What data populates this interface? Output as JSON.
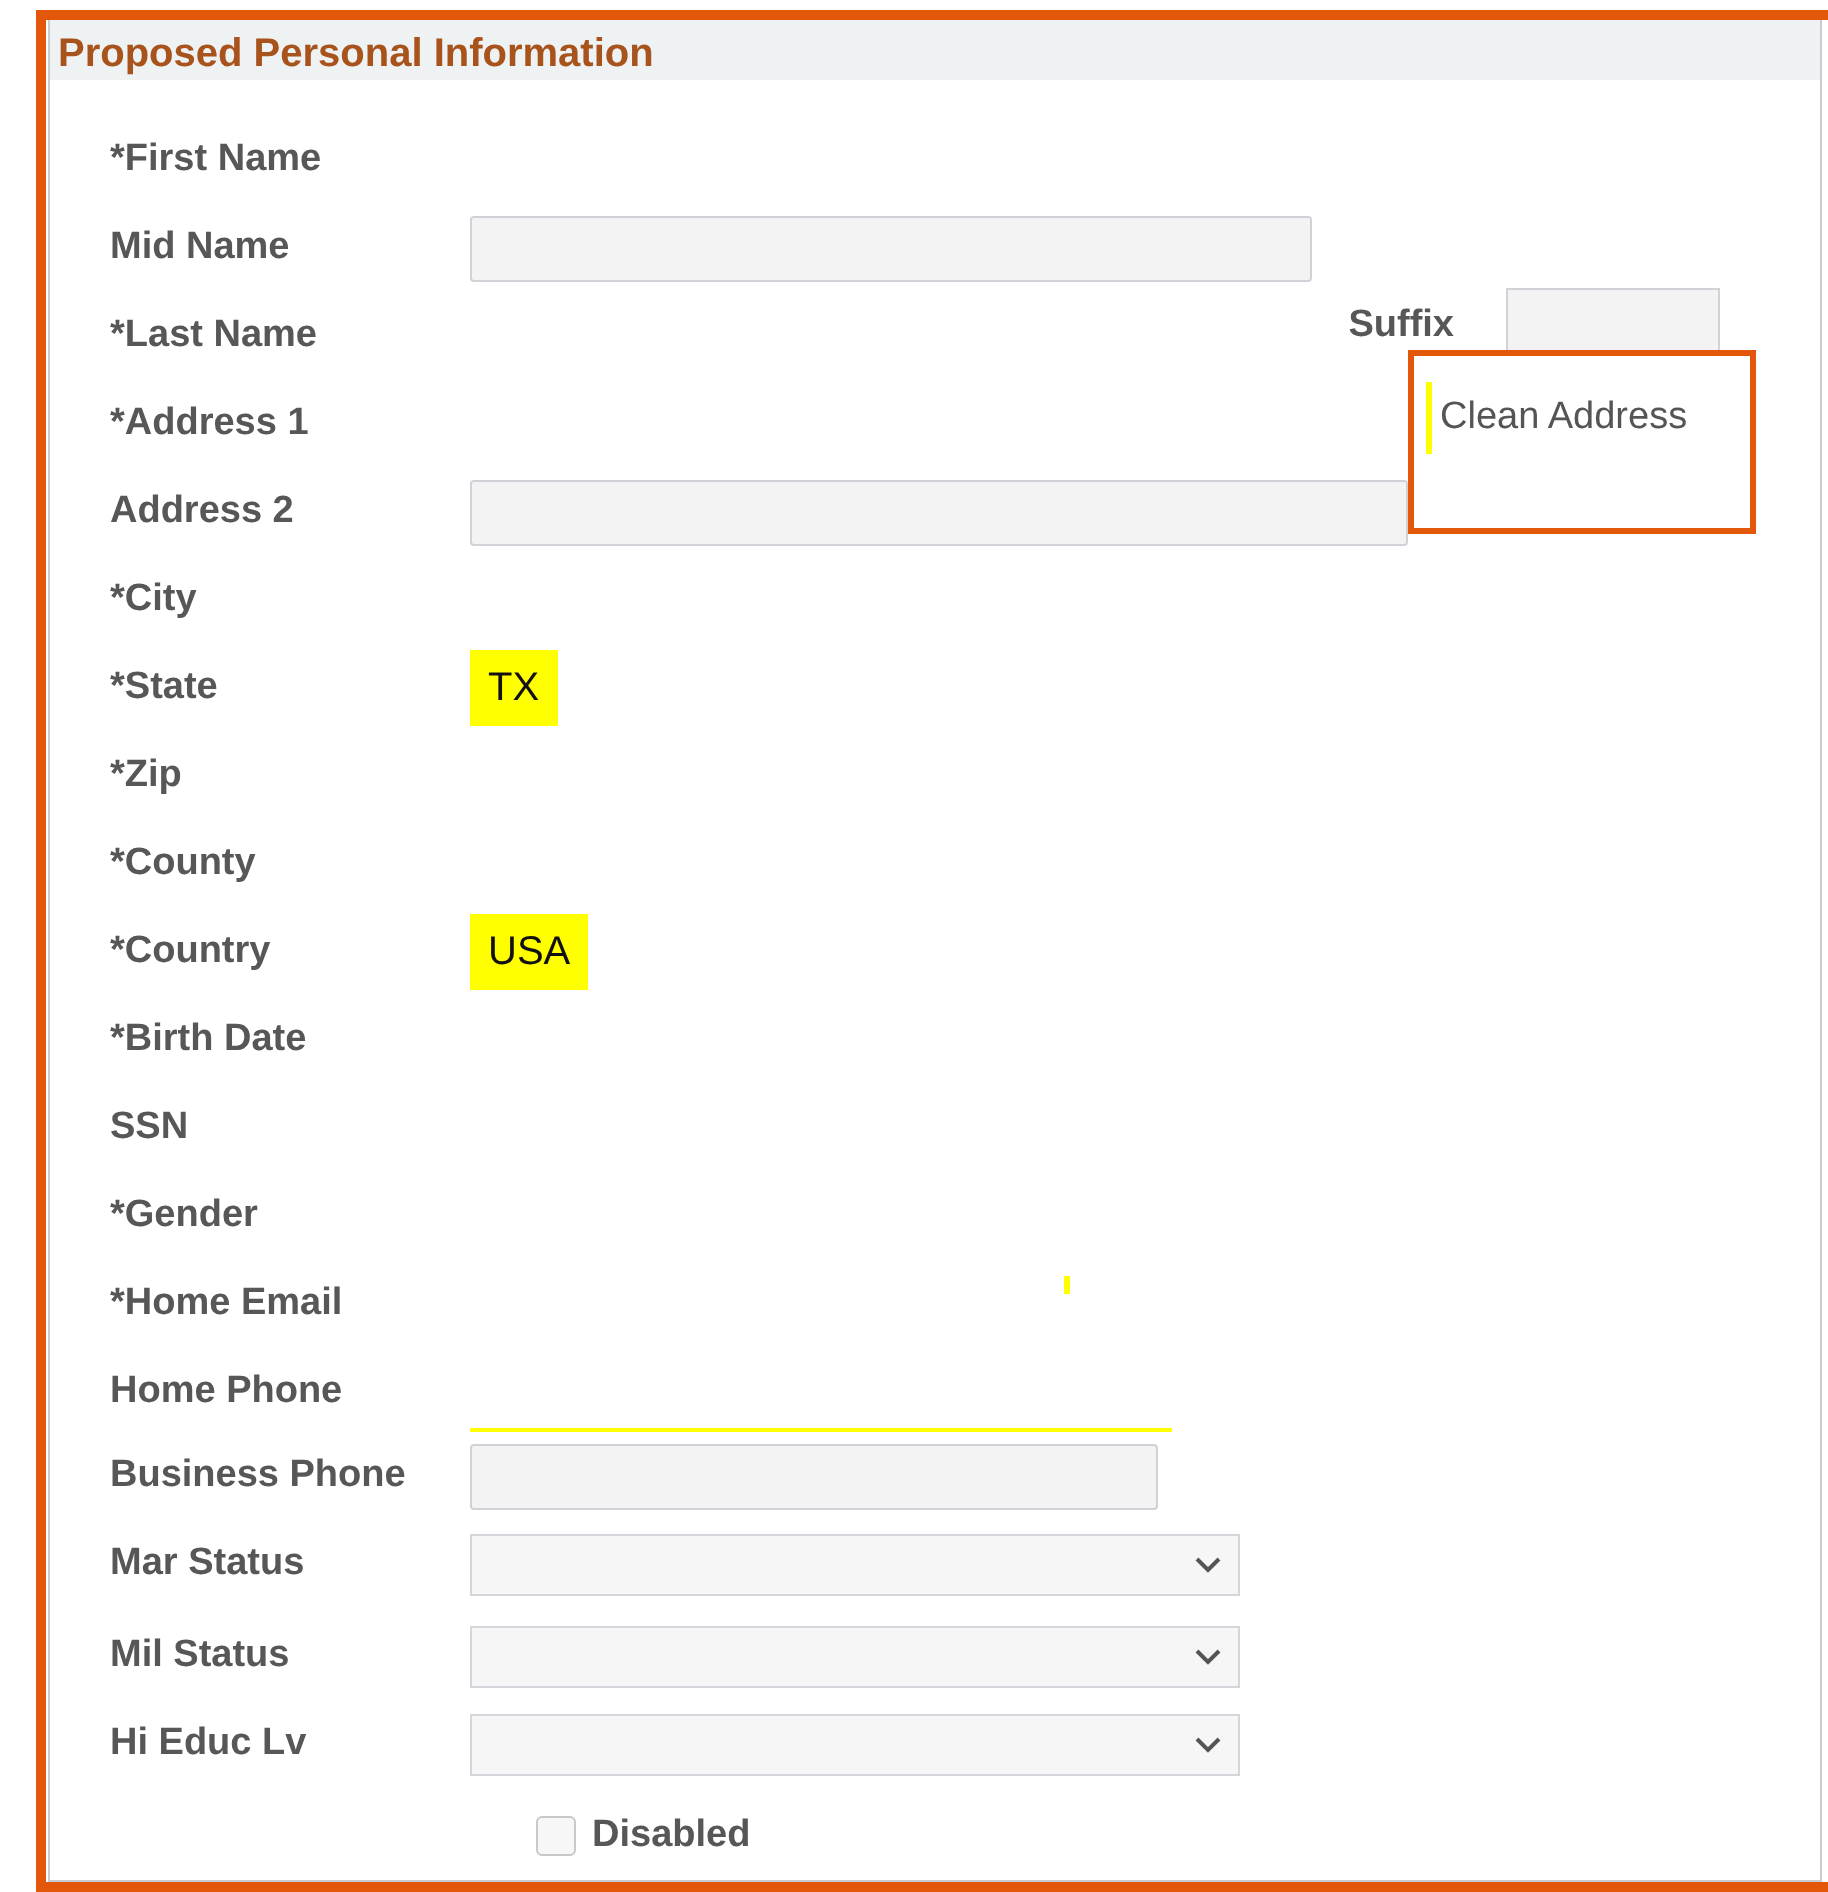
{
  "section": {
    "title": "Proposed Personal Information"
  },
  "fields": [
    {
      "label": "*First Name",
      "kind": "none"
    },
    {
      "label": "Mid Name",
      "kind": "text"
    },
    {
      "label": "*Last Name",
      "kind": "none"
    },
    {
      "label": "*Address 1",
      "kind": "none"
    },
    {
      "label": "Address 2",
      "kind": "text"
    },
    {
      "label": "*City",
      "kind": "none"
    },
    {
      "label": "*State",
      "kind": "highlight",
      "value": "TX"
    },
    {
      "label": "*Zip",
      "kind": "none"
    },
    {
      "label": "*County",
      "kind": "none"
    },
    {
      "label": "*Country",
      "kind": "highlight",
      "value": "USA"
    },
    {
      "label": "*Birth Date",
      "kind": "none"
    },
    {
      "label": "SSN",
      "kind": "none"
    },
    {
      "label": "*Gender",
      "kind": "none"
    },
    {
      "label": "*Home Email",
      "kind": "marker"
    },
    {
      "label": "Home Phone",
      "kind": "underline"
    },
    {
      "label": "Business Phone",
      "kind": "text"
    },
    {
      "label": "Mar Status",
      "kind": "select"
    },
    {
      "label": "Mil Status",
      "kind": "select"
    },
    {
      "label": "Hi Educ Lv",
      "kind": "select"
    }
  ],
  "suffix": {
    "label": "Suffix"
  },
  "clean_address": {
    "label": "Clean Address"
  },
  "disabled_checkbox": {
    "label": "Disabled",
    "checked": false
  }
}
